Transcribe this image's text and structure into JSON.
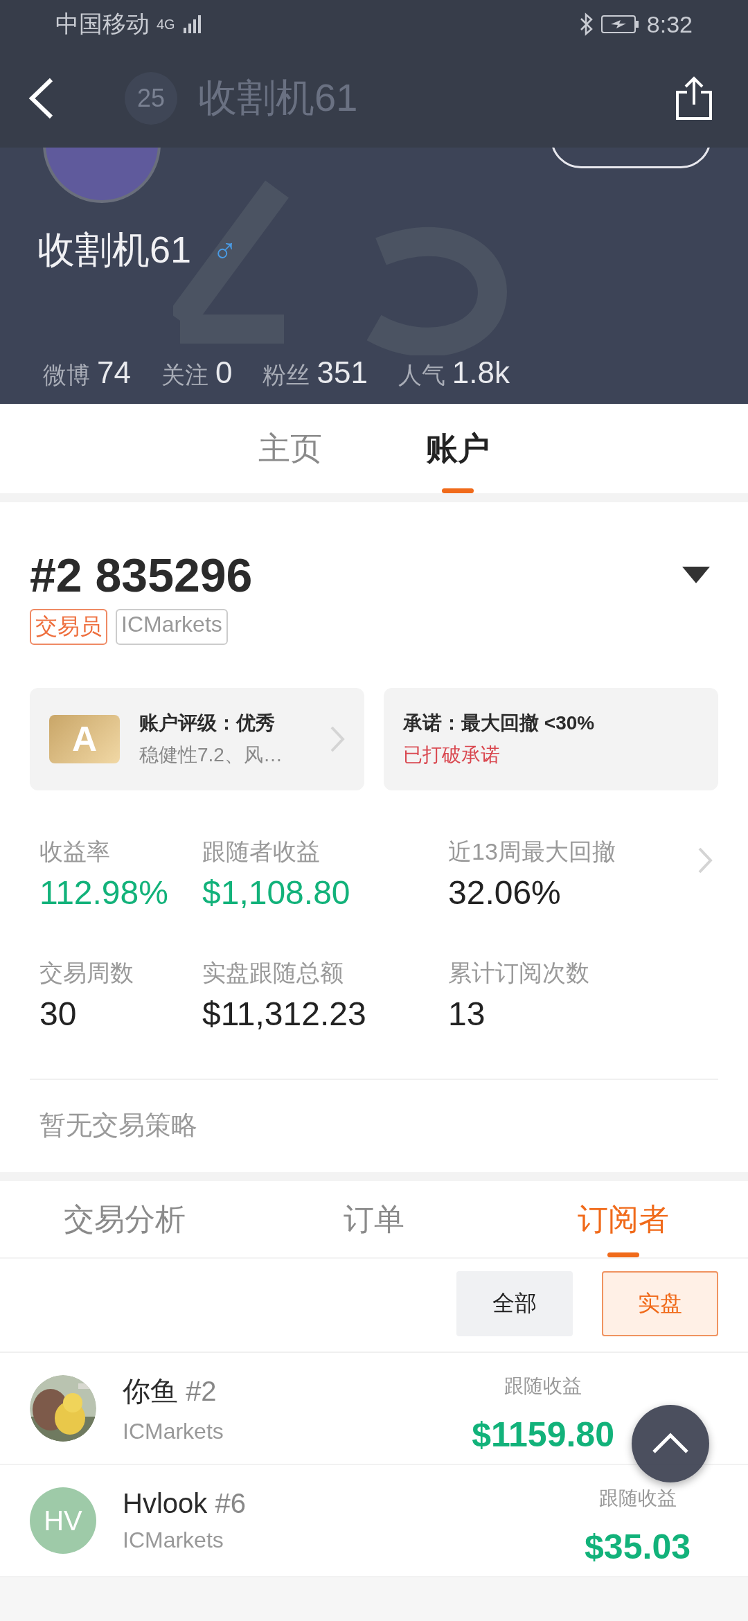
{
  "status_bar": {
    "carrier": "中国移动",
    "network": "4G",
    "time": "8:32"
  },
  "nav": {
    "avatar_text": "25",
    "title": "收割机61"
  },
  "profile": {
    "name": "收割机61",
    "gender_symbol": "♂",
    "stats": [
      {
        "label": "微博",
        "value": "74"
      },
      {
        "label": "关注",
        "value": "0"
      },
      {
        "label": "粉丝",
        "value": "351"
      },
      {
        "label": "人气",
        "value": "1.8k"
      }
    ]
  },
  "main_tabs": [
    {
      "label": "主页",
      "selected": false
    },
    {
      "label": "账户",
      "selected": true
    }
  ],
  "account": {
    "number": "#2 835296",
    "tags": [
      {
        "label": "交易员",
        "kind": "role"
      },
      {
        "label": "ICMarkets",
        "kind": "broker"
      }
    ],
    "rating_card": {
      "grade": "A",
      "title": "账户评级：优秀",
      "subtitle": "稳健性7.2、风…"
    },
    "promise_card": {
      "title": "承诺：最大回撤 <30%",
      "status": "已打破承诺",
      "broken": true
    },
    "metrics": [
      {
        "label": "收益率",
        "value": "112.98%",
        "positive": true
      },
      {
        "label": "跟随者收益",
        "value": "$1,108.80",
        "positive": true
      },
      {
        "label": "近13周最大回撤",
        "value": "32.06%",
        "positive": false
      },
      {
        "label": "交易周数",
        "value": "30",
        "positive": false
      },
      {
        "label": "实盘跟随总额",
        "value": "$11,312.23",
        "positive": false
      },
      {
        "label": "累计订阅次数",
        "value": "13",
        "positive": false
      }
    ],
    "strategy": "暂无交易策略"
  },
  "sub_tabs": [
    {
      "label": "交易分析",
      "selected": false
    },
    {
      "label": "订单",
      "selected": false
    },
    {
      "label": "订阅者",
      "selected": true
    }
  ],
  "filters": [
    {
      "label": "全部",
      "selected": false
    },
    {
      "label": "实盘",
      "selected": true
    }
  ],
  "subscribers": [
    {
      "name": "你鱼",
      "number": "#2",
      "broker": "ICMarkets",
      "profit_label": "跟随收益",
      "profit": "$1159.80"
    },
    {
      "avatar": {
        "kind": "initials",
        "text": "HV",
        "color": "#9ecaa8"
      },
      "name": "Hvlook",
      "number": "#6",
      "broker": "ICMarkets",
      "profit_label": "跟随收益",
      "profit": "$35.03"
    }
  ]
}
